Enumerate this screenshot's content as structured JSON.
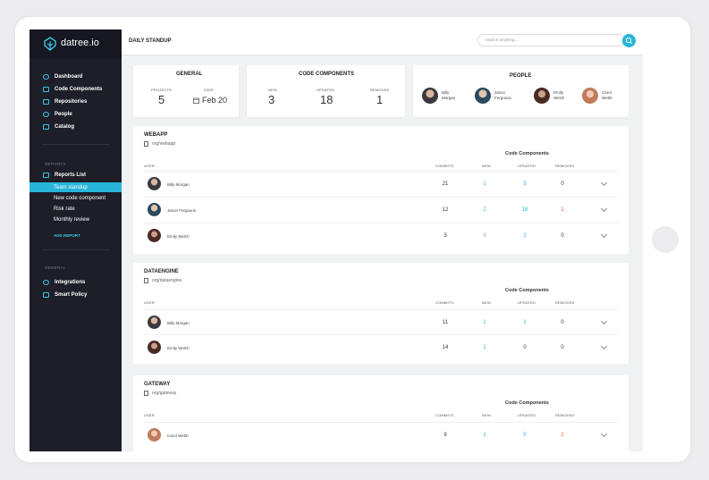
{
  "app": {
    "logo_text": "datree.io",
    "page_title": "DAILY STANDUP",
    "accent_color": "#28b5d8"
  },
  "search": {
    "placeholder": "Search anything..."
  },
  "sidebar": {
    "main_items": [
      {
        "label": "Dashboard",
        "icon": "dashboard-icon"
      },
      {
        "label": "Code Components",
        "icon": "folder-icon"
      },
      {
        "label": "Repositories",
        "icon": "bookmark-icon"
      },
      {
        "label": "People",
        "icon": "person-icon"
      },
      {
        "label": "Catalog",
        "icon": "catalog-icon"
      }
    ],
    "reports_section": "REPORTS",
    "reports_list_label": "Reports List",
    "report_items": [
      "Team standup",
      "New code component",
      "Risk rate",
      "Monthly review"
    ],
    "active_report": "Team standup",
    "add_report": "ADD REPORT",
    "general_section": "GENERAL",
    "general_items": [
      {
        "label": "Integrations",
        "icon": "plug-icon"
      },
      {
        "label": "Smart Policy",
        "icon": "clipboard-icon"
      }
    ]
  },
  "summary": {
    "general": {
      "title": "GENERAL",
      "projects_label": "PROJECTS",
      "projects_value": "5",
      "date_label": "DATE",
      "date_value": "Feb 20"
    },
    "code_components": {
      "title": "CODE COMPONENTS",
      "new_label": "NEW",
      "new_value": "3",
      "updated_label": "UPDATED",
      "updated_value": "18",
      "removed_label": "REMOVED",
      "removed_value": "1"
    },
    "people": {
      "title": "PEOPLE",
      "members": [
        {
          "first": "Billy",
          "last": "Morgan"
        },
        {
          "first": "Jason",
          "last": "Ferguson"
        },
        {
          "first": "Emily",
          "last": "Welch"
        },
        {
          "first": "Carol",
          "last": "Webb"
        }
      ]
    }
  },
  "table_headers": {
    "code_components": "Code Components",
    "user": "USER",
    "commits": "COMMITS",
    "new": "NEW",
    "updated": "UPDATED",
    "removed": "REMOVED"
  },
  "projects": [
    {
      "name": "WEBAPP",
      "org": "org/webapp",
      "rows": [
        {
          "user": "Billy Morgan",
          "commits": "21",
          "new": "1",
          "updated": "5",
          "removed": "0"
        },
        {
          "user": "Jason Ferguson",
          "commits": "12",
          "new": "2",
          "updated": "18",
          "removed": "1"
        },
        {
          "user": "Emily Welch",
          "commits": "3",
          "new": "0",
          "updated": "2",
          "removed": "0"
        }
      ]
    },
    {
      "name": "DATAENGINE",
      "org": "org/dataengine",
      "rows": [
        {
          "user": "Billy Morgan",
          "commits": "11",
          "new": "1",
          "updated": "1",
          "removed": "0"
        },
        {
          "user": "Emily Welch",
          "commits": "14",
          "new": "1",
          "updated": "0",
          "removed": "0"
        }
      ]
    },
    {
      "name": "GATEWAY",
      "org": "org/gateway",
      "rows": [
        {
          "user": "Carol Webb",
          "commits": "9",
          "new": "1",
          "updated": "5",
          "removed": "2"
        }
      ]
    }
  ]
}
